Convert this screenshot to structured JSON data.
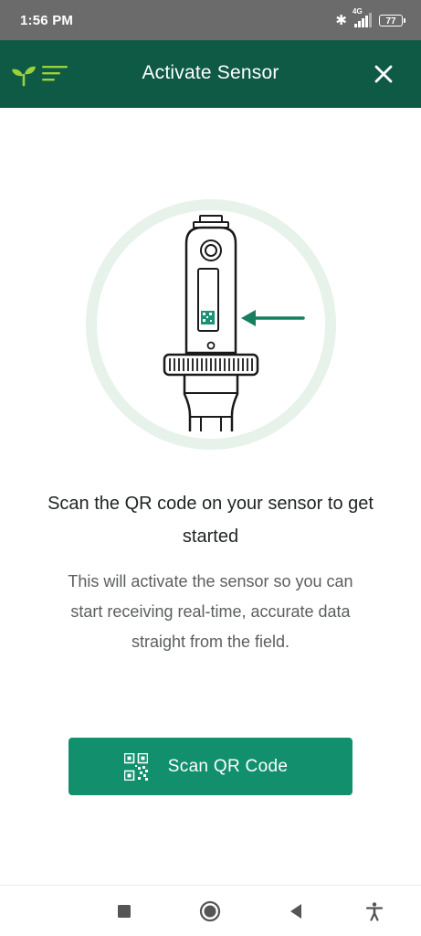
{
  "status_bar": {
    "time": "1:56 PM",
    "network": "4G",
    "battery": "77",
    "icons": [
      "bluetooth-icon",
      "signal-icon",
      "battery-icon"
    ]
  },
  "header": {
    "title": "Activate Sensor",
    "menu_icon": "sprout-menu-icon",
    "close_icon": "close-icon",
    "background": "#0f5a45"
  },
  "content": {
    "illustration": "sensor-qr-illustration",
    "headline": "Scan the QR code on your sensor to get started",
    "description": "This will activate the sensor so you can start receiving real-time, accurate data straight from the field."
  },
  "scan_button": {
    "label": "Scan QR Code",
    "icon": "qr-code-icon",
    "color": "#12906d"
  },
  "nav_bar": {
    "buttons": [
      "recent-apps-icon",
      "home-icon",
      "back-icon",
      "accessibility-icon"
    ]
  }
}
